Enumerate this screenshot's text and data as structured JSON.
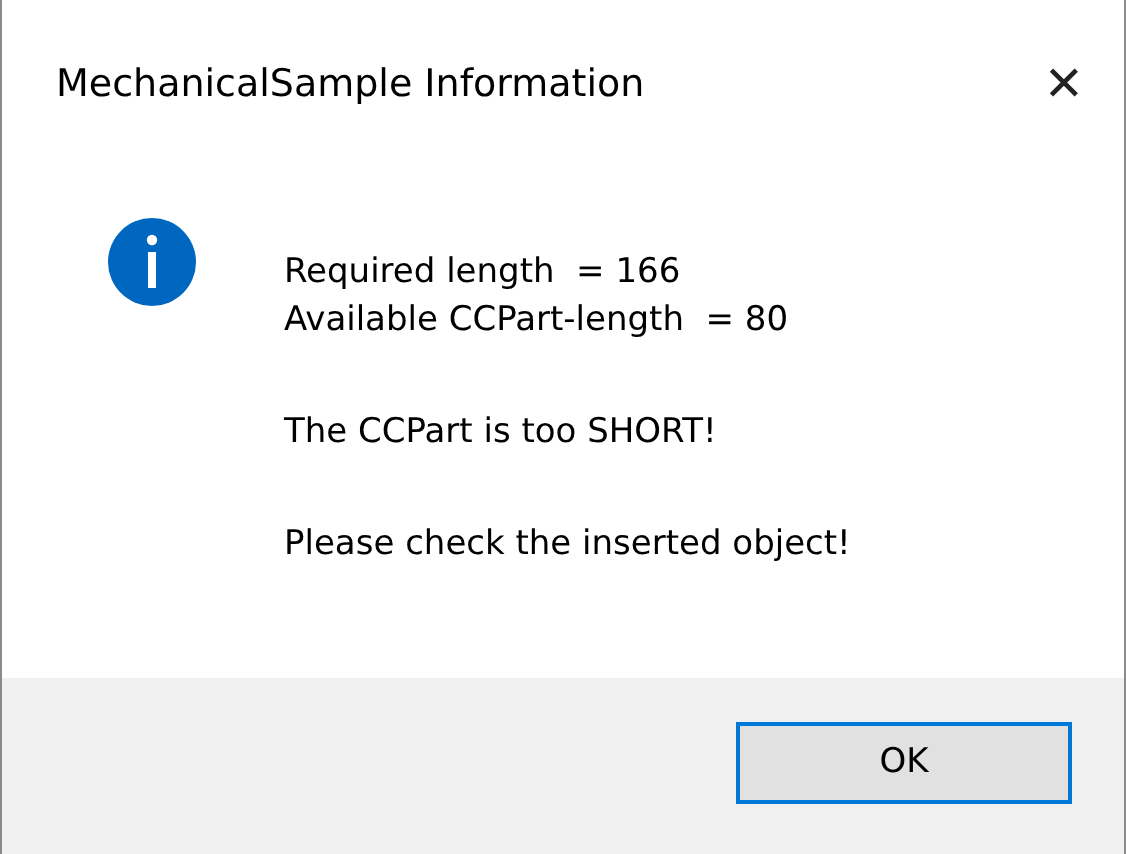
{
  "window": {
    "title": "MechanicalSample Information",
    "close_glyph": "✕"
  },
  "icon": {
    "kind": "information"
  },
  "message": [
    [
      "Required length  = 166",
      "Available CCPart-length  = 80"
    ],
    [
      "The CCPart is too SHORT!"
    ],
    [
      "Please check the inserted object!"
    ]
  ],
  "buttons": [
    {
      "label": "OK",
      "selected": true
    }
  ]
}
